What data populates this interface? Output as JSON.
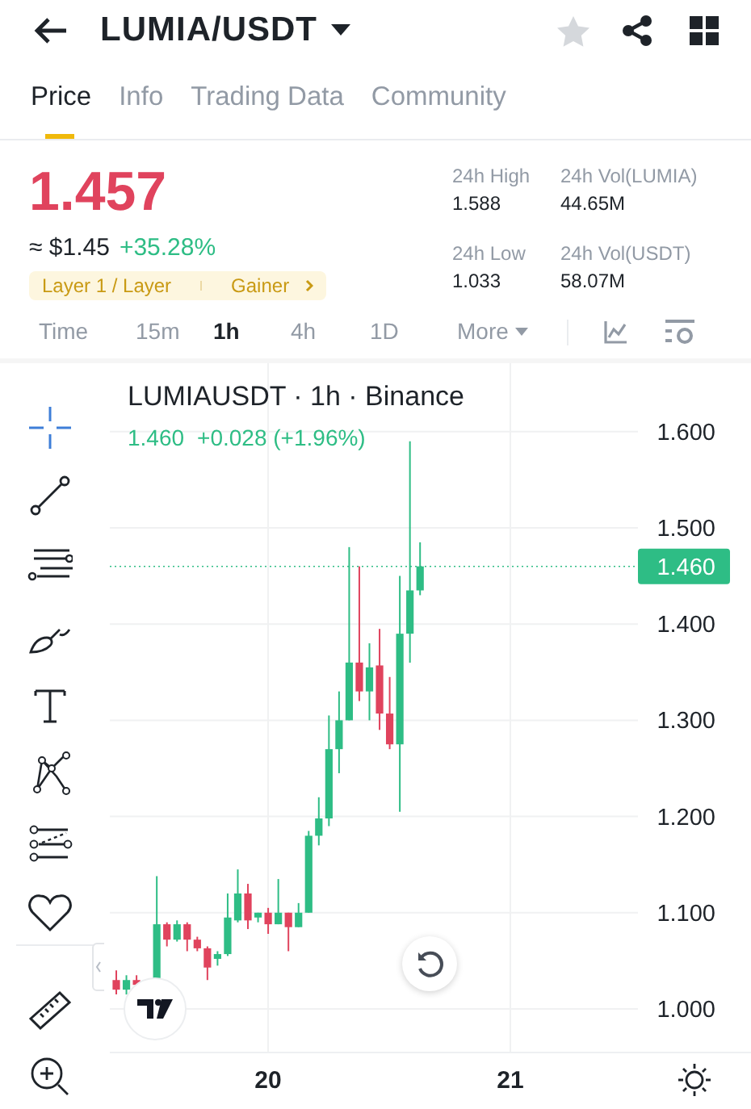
{
  "header": {
    "title": "LUMIA/USDT",
    "favorite": false
  },
  "tabs": [
    {
      "label": "Price",
      "selected": true
    },
    {
      "label": "Info",
      "selected": false
    },
    {
      "label": "Trading Data",
      "selected": false
    },
    {
      "label": "Community",
      "selected": false
    }
  ],
  "price": {
    "last": "1.457",
    "falling": true,
    "fiat": "≈ $1.45",
    "change": "+35.28%"
  },
  "tags": [
    "Layer 1 / Layer",
    "Gainer"
  ],
  "stats": [
    {
      "label": "24h High",
      "value": "1.588"
    },
    {
      "label": "24h Vol(LUMIA)",
      "value": "44.65M"
    },
    {
      "label": "24h Low",
      "value": "1.033"
    },
    {
      "label": "24h Vol(USDT)",
      "value": "58.07M"
    }
  ],
  "intervals": [
    {
      "label": "Time",
      "selected": false,
      "dropdown": false
    },
    {
      "label": "15m",
      "selected": false,
      "dropdown": false
    },
    {
      "label": "1h",
      "selected": true,
      "dropdown": false
    },
    {
      "label": "4h",
      "selected": false,
      "dropdown": false
    },
    {
      "label": "1D",
      "selected": false,
      "dropdown": false
    },
    {
      "label": "More",
      "selected": false,
      "dropdown": true
    }
  ],
  "tools": [
    {
      "kind": "crosshair",
      "selected": true
    },
    {
      "kind": "trend-line",
      "selected": false
    },
    {
      "kind": "parallel-lines",
      "selected": false
    },
    {
      "kind": "brush",
      "selected": false
    },
    {
      "kind": "text",
      "selected": false
    },
    {
      "kind": "pattern",
      "selected": false
    },
    {
      "kind": "projection",
      "selected": false
    },
    {
      "kind": "favorites",
      "selected": false
    },
    {
      "kind": "ruler",
      "selected": false
    },
    {
      "kind": "zoom-in",
      "selected": false
    }
  ],
  "chart": {
    "title": "LUMIAUSDT · 1h · Binance",
    "legend_price": "1.460",
    "legend_change": "+0.028 (+1.96%)",
    "last_price": "1.460",
    "price_labels": [
      "1.600",
      "1.500",
      "1.400",
      "1.300",
      "1.200",
      "1.100",
      "1.000"
    ],
    "time_labels": [
      "20",
      "21"
    ]
  }
}
